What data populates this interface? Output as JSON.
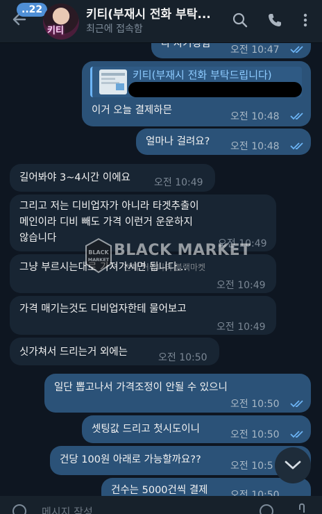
{
  "header": {
    "unread_badge": "22",
    "avatar_label": "키티",
    "title": "키티(부재시 전화 부탁...",
    "status": "최근에 접속함"
  },
  "messages": [
    {
      "side": "out",
      "text": "다 자기경험",
      "time": "오전 10:47",
      "read": true
    },
    {
      "side": "out",
      "reply_to": "키티(부재시 전화 부탁드립니다)",
      "text": "이거 오늘 결제하믄",
      "time": "오전 10:48",
      "read": true
    },
    {
      "side": "out",
      "text": "얼마나 걸려요?",
      "time": "오전 10:48",
      "read": true
    },
    {
      "side": "in",
      "text": "길어봐야 3~4시간 이에요",
      "time": "오전 10:49"
    },
    {
      "side": "in",
      "lines": [
        "그리고 저는 디비업자가 아니라 타겟추출이",
        "메인이라 디비 빼도 가격 이런거 운운하지",
        "않습니다"
      ],
      "time": "오전 10:49"
    },
    {
      "side": "in",
      "text": "그냥 부르시는대로 가져가시면 됩니다...",
      "time": "오전 10:49"
    },
    {
      "side": "in",
      "text": "가격 매기는것도 디비업자한테 물어보고",
      "time": "오전 10:49"
    },
    {
      "side": "in",
      "text": "싯가쳐서 드리는거 외에는",
      "time": "오전 10:50"
    },
    {
      "side": "out",
      "text": "일단 뽑고나서 가격조정이 안될 수 있으니",
      "time": "오전 10:50",
      "read": true
    },
    {
      "side": "out",
      "text": "셋팅값 드리고 첫시도이니",
      "time": "오전 10:50",
      "read": true
    },
    {
      "side": "out",
      "text": "건당 100원 아래로 가능할까요??",
      "time": "오전 10:5",
      "read": true
    },
    {
      "side": "out",
      "text": "건수는 5000건씩 결제",
      "time": "오전 10:50",
      "read": true
    }
  ],
  "watermark": {
    "brand": "BLACK MARKET",
    "sub": "전체 커뮤니티 블랙마켓",
    "logo_text": "BLACK MARKET"
  },
  "composer": {
    "placeholder": "메시지 작성"
  },
  "colors": {
    "background": "#0e1621",
    "header": "#17212b",
    "outgoing_bubble": "#2b5278",
    "incoming_bubble": "#182533",
    "accent": "#4f8fd6",
    "check": "#6cb4f5"
  }
}
